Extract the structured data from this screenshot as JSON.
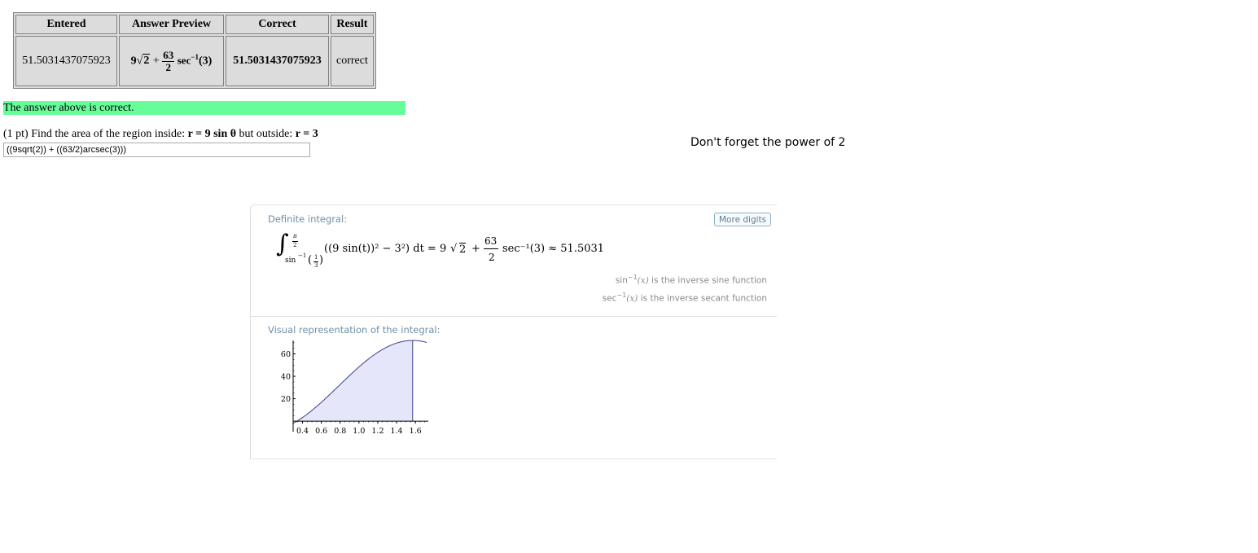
{
  "results_table": {
    "headers": [
      "Entered",
      "Answer Preview",
      "Correct",
      "Result"
    ],
    "row": {
      "entered": "51.5031437075923",
      "preview": {
        "coef": "9",
        "radicand": "2",
        "plus": "+",
        "frac_num": "63",
        "frac_den": "2",
        "func": "sec",
        "sup": "−1",
        "arg": "(3)"
      },
      "correct": "51.5031437075923",
      "result": "correct"
    }
  },
  "banner": "The answer above is correct.",
  "problem": {
    "prefix": "(1 pt) Find the area of the region inside: ",
    "inside_eq": "r = 9 sin θ",
    "middle": " but outside: ",
    "outside_eq": "r = 3"
  },
  "answer_input": {
    "value": "((9sqrt(2)) + ((63/2)arcsec(3)))"
  },
  "note": "Don't forget the power of 2",
  "wolfram": {
    "pod1": {
      "title": "Definite integral:",
      "more_digits": "More digits",
      "upper_num": "π",
      "upper_den": "2",
      "lower_func": "sin",
      "lower_sup": "−1",
      "lower_frac_num": "1",
      "lower_frac_den": "3",
      "integrand": "((9 sin(t))² − 3²) dt = 9",
      "rad": "2",
      "plus": "+",
      "frac_num": "63",
      "frac_den": "2",
      "result_tail": "sec⁻¹(3) ≈ 51.5031",
      "notes": [
        {
          "func": "sin",
          "sup": "−1",
          "arg": "(x)",
          "text": "is the inverse sine function"
        },
        {
          "func": "sec",
          "sup": "−1",
          "arg": "(x)",
          "text": "is the inverse secant function"
        }
      ]
    },
    "pod2": {
      "title": "Visual representation of the integral:"
    }
  },
  "chart_data": {
    "type": "area",
    "title": "",
    "xlabel": "",
    "ylabel": "",
    "x_ticks": [
      "0.4",
      "0.6",
      "0.8",
      "1.0",
      "1.2",
      "1.4",
      "1.6"
    ],
    "y_ticks": [
      "20",
      "40",
      "60"
    ],
    "xlim": [
      0.3,
      1.72
    ],
    "ylim": [
      -5,
      72
    ],
    "function": "(9 sin(t))^2 - 3^2",
    "shade_from": 0.3398,
    "shade_to": 1.5708,
    "fill_color": "#e6e6fa",
    "line_color": "#3d3d8c",
    "grid": false
  }
}
